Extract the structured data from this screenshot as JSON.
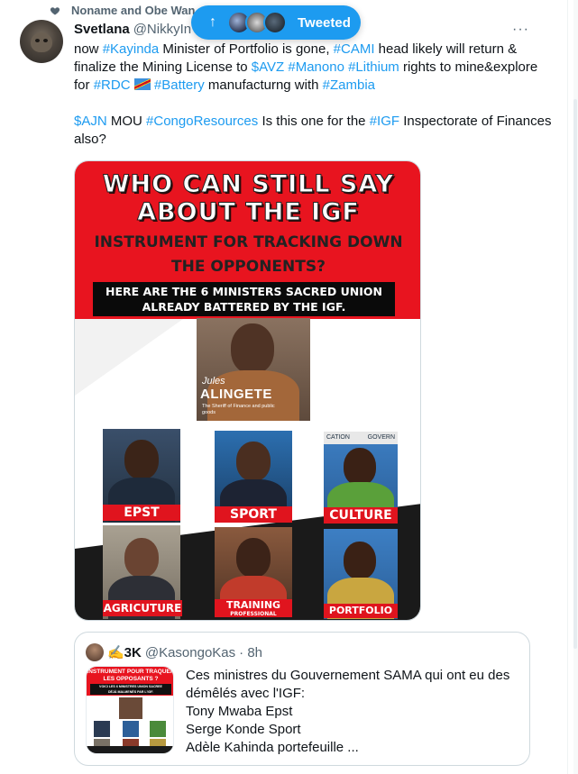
{
  "social_context": {
    "text": "Noname and Obe Wan"
  },
  "new_tweets_pill": {
    "label": "Tweeted"
  },
  "tweet": {
    "author_name": "Svetlana",
    "author_handle": "@NikkyIn",
    "more_label": "···",
    "paragraph1": [
      {
        "t": "now "
      },
      {
        "t": "#Kayinda",
        "tag": true
      },
      {
        "t": " Minister of Portfolio is gone, "
      },
      {
        "t": "#CAMI",
        "tag": true
      },
      {
        "t": " head likely will return & finalize the Mining License to "
      },
      {
        "t": "$AVZ",
        "tag": true
      },
      {
        "t": " "
      },
      {
        "t": "#Manono",
        "tag": true
      },
      {
        "t": " "
      },
      {
        "t": "#Lithium",
        "tag": true
      },
      {
        "t": " rights to mine&explore for "
      },
      {
        "t": "#RDC",
        "tag": true
      },
      {
        "t": " "
      },
      {
        "t": "FLAG",
        "flag": true
      },
      {
        "t": "#Battery",
        "tag": true
      },
      {
        "t": " manufacturng with "
      },
      {
        "t": "#Zambia",
        "tag": true
      }
    ],
    "paragraph2": [
      {
        "t": "$AJN",
        "tag": true
      },
      {
        "t": " MOU "
      },
      {
        "t": "#CongoResources",
        "tag": true
      },
      {
        "t": " Is this one for the "
      },
      {
        "t": "#IGF",
        "tag": true
      },
      {
        "t": " Inspectorate of Finances also?"
      }
    ],
    "flag_icon": "drc-flag-icon"
  },
  "image": {
    "title_line1": "WHO CAN STILL SAY",
    "title_line2": "ABOUT THE IGF",
    "sub_line1": "INSTRUMENT FOR TRACKING DOWN",
    "sub_line2": "THE OPPONENTS?",
    "black_line1": "HERE ARE THE 6 MINISTERS SACRED UNION",
    "black_line2": "ALREADY BATTERED BY THE IGF.",
    "main_person_first": "Jules",
    "main_person_last": "ALINGETE",
    "main_person_role": "The Sheriff of Finance and public goods",
    "captions": [
      "EPST",
      "SPORT",
      "CULTURE",
      "AGRICUTURE",
      "TRAINING",
      "PORTFOLIO"
    ],
    "caption_extra": "PROFESSIONAL",
    "culture_top_left": "CATION",
    "culture_top_right": "GOVERN",
    "colors": {
      "red": "#e8141f",
      "black": "#0a0a0a"
    }
  },
  "quote": {
    "author_name": "✍️3K",
    "author_handle": "@KasongoKas",
    "time": "· 8h",
    "lines": [
      "Ces ministres du Gouvernement SAMA qui ont eu des",
      "démêlés avec l'IGF:",
      "Tony Mwaba Epst",
      "Serge Konde Sport",
      "Adèle Kahinda portefeuille ..."
    ],
    "thumb_line1": "INSTRUMENT POUR TRAQUER",
    "thumb_line2": "LES OPPOSANTS ?",
    "thumb_line3": "VOICI LES 6 MINISTRES UNION SACREE",
    "thumb_line4": "DÉJÀ MALMENÉS PAR L'IGF."
  }
}
